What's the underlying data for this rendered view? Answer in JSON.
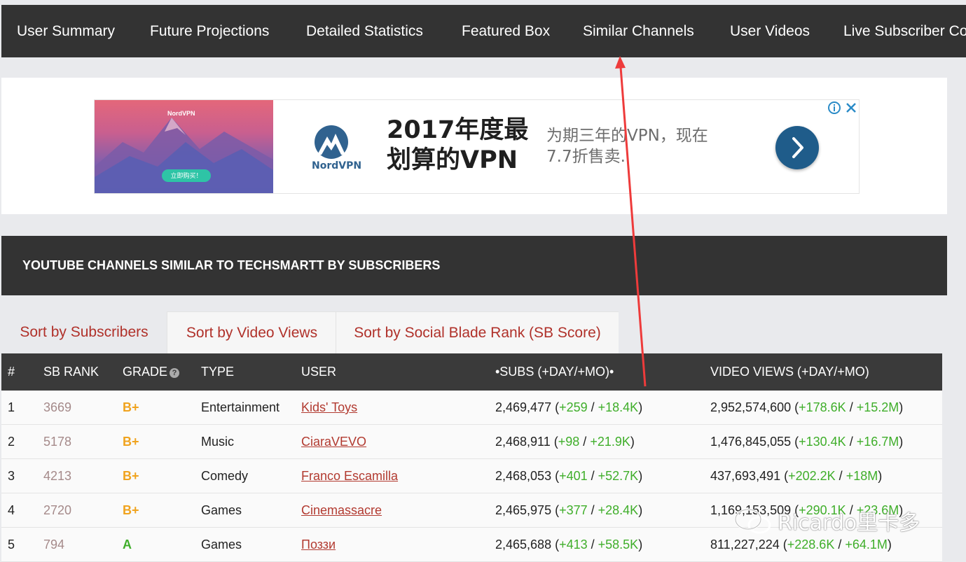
{
  "nav": {
    "items": [
      {
        "label": "User Summary"
      },
      {
        "label": "Future Projections"
      },
      {
        "label": "Detailed Statistics"
      },
      {
        "label": "Featured Box"
      },
      {
        "label": "Similar Channels"
      },
      {
        "label": "User Videos"
      },
      {
        "label": "Live Subscriber Co"
      }
    ]
  },
  "ad": {
    "image_brand": "NordVPN",
    "image_cta": "立即购买！",
    "logo_word": "NordVPN",
    "headline_line1": "2017年度最",
    "headline_line2": "划算的VPN",
    "sub_line1": "为期三年的VPN，现在",
    "sub_line2": "7.7折售卖.",
    "info_icon": "info-icon",
    "close_icon": "close-icon",
    "next_icon": "chevron-right-icon",
    "accent": "#1f5c8a"
  },
  "section": {
    "title": "YOUTUBE CHANNELS SIMILAR TO TECHSMARTT BY SUBSCRIBERS"
  },
  "tabs": [
    {
      "label": "Sort by Subscribers",
      "active": true
    },
    {
      "label": "Sort by Video Views",
      "active": false
    },
    {
      "label": "Sort by Social Blade Rank (SB Score)",
      "active": false
    }
  ],
  "table": {
    "headers": {
      "num": "#",
      "sb_rank": "SB RANK",
      "grade": "GRADE",
      "type": "TYPE",
      "user": "USER",
      "subs": "•SUBS (+DAY/+MO)•",
      "views": "VIDEO VIEWS (+DAY/+MO)"
    },
    "grade_help_icon": "?",
    "rows": [
      {
        "num": "1",
        "sb_rank": "3669",
        "grade": "B+",
        "grade_color": "#f0a31e",
        "type": "Entertainment",
        "user": "Kids' Toys",
        "subs": "2,469,477",
        "subs_day": "+259",
        "subs_mo": "+18.4K",
        "views": "2,952,574,600",
        "views_day": "+178.6K",
        "views_mo": "+15.2M"
      },
      {
        "num": "2",
        "sb_rank": "5178",
        "grade": "B+",
        "grade_color": "#f0a31e",
        "type": "Music",
        "user": "CiaraVEVO",
        "subs": "2,468,911",
        "subs_day": "+98",
        "subs_mo": "+21.9K",
        "views": "1,476,845,055",
        "views_day": "+130.4K",
        "views_mo": "+16.7M"
      },
      {
        "num": "3",
        "sb_rank": "4213",
        "grade": "B+",
        "grade_color": "#f0a31e",
        "type": "Comedy",
        "user": "Franco Escamilla",
        "subs": "2,468,053",
        "subs_day": "+401",
        "subs_mo": "+52.7K",
        "views": "437,693,491",
        "views_day": "+202.2K",
        "views_mo": "+18M"
      },
      {
        "num": "4",
        "sb_rank": "2720",
        "grade": "B+",
        "grade_color": "#f0a31e",
        "type": "Games",
        "user": "Cinemassacre",
        "subs": "2,465,975",
        "subs_day": "+377",
        "subs_mo": "+28.4K",
        "views": "1,169,153,509",
        "views_day": "+290.1K",
        "views_mo": "+23.6M"
      },
      {
        "num": "5",
        "sb_rank": "794",
        "grade": "A",
        "grade_color": "#3fae2a",
        "type": "Games",
        "user": "Поззи",
        "subs": "2,465,688",
        "subs_day": "+413",
        "subs_mo": "+58.5K",
        "views": "811,227,224",
        "views_day": "+228.6K",
        "views_mo": "+64.1M"
      }
    ]
  },
  "watermark": {
    "text": "Ricardo里卡多",
    "icon": "wechat-icon"
  },
  "colors": {
    "nav_bg": "#333333",
    "link": "#b23a30",
    "positive": "#3fae2a",
    "annotation_arrow": "#ee3b3b"
  }
}
